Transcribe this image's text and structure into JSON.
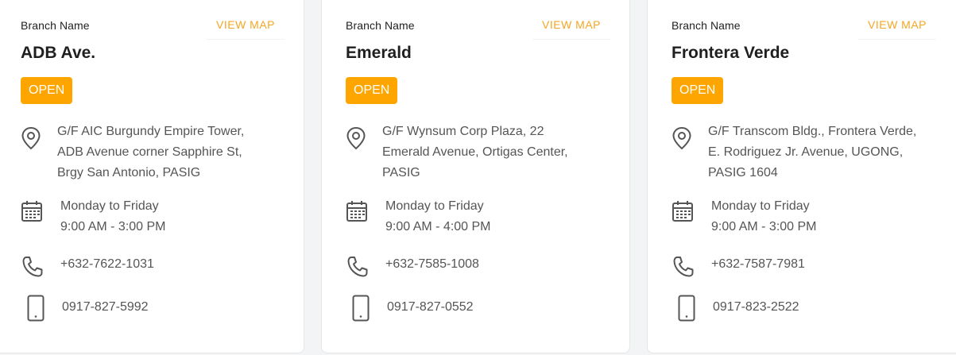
{
  "accent_color": "#ffa500",
  "branches": [
    {
      "label": "Branch Name",
      "view_map": "VIEW MAP",
      "name": "ADB Ave.",
      "status": "OPEN",
      "address": [
        "G/F AIC Burgundy Empire Tower,",
        "ADB Avenue corner Sapphire St,",
        "Brgy San Antonio, PASIG"
      ],
      "hours": [
        "Monday to Friday",
        "9:00 AM - 3:00 PM"
      ],
      "phone": "+632-7622-1031",
      "mobile": "0917-827-5992"
    },
    {
      "label": "Branch Name",
      "view_map": "VIEW MAP",
      "name": "Emerald",
      "status": "OPEN",
      "address": [
        "G/F Wynsum Corp Plaza, 22",
        "Emerald Avenue, Ortigas Center,",
        "PASIG"
      ],
      "hours": [
        "Monday to Friday",
        "9:00 AM - 4:00 PM"
      ],
      "phone": "+632-7585-1008",
      "mobile": "0917-827-0552"
    },
    {
      "label": "Branch Name",
      "view_map": "VIEW MAP",
      "name": "Frontera Verde",
      "status": "OPEN",
      "address": [
        "G/F Transcom Bldg., Frontera Verde,",
        "E. Rodriguez Jr. Avenue, UGONG,",
        "PASIG 1604"
      ],
      "hours": [
        "Monday to Friday",
        "9:00 AM - 3:00 PM"
      ],
      "phone": "+632-7587-7981",
      "mobile": "0917-823-2522"
    }
  ],
  "icons": {
    "address": "map-pin-icon",
    "hours": "calendar-icon",
    "phone": "phone-icon",
    "mobile": "mobile-phone-icon"
  }
}
